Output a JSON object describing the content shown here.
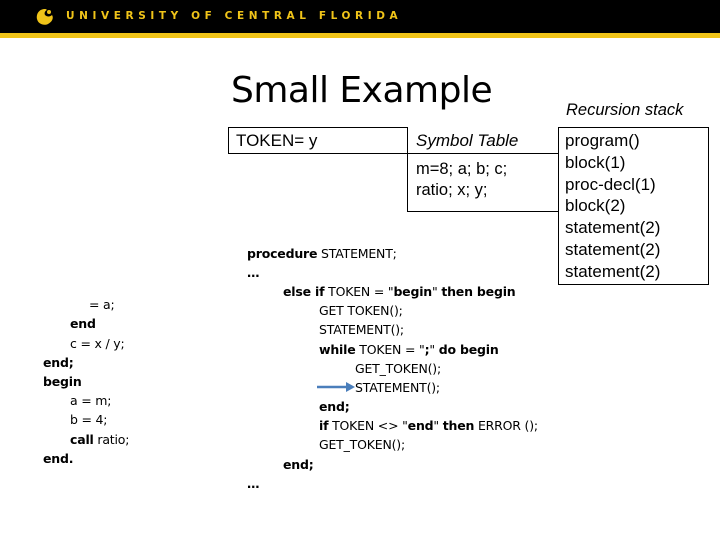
{
  "header": {
    "university_name": "UNIVERSITY OF CENTRAL FLORIDA",
    "logo_icon": "ucf-pegasus-logo-icon",
    "brand_colors": {
      "bar": "#000000",
      "accent": "#f0c419"
    }
  },
  "slide": {
    "title": "Small Example",
    "token_label": "TOKEN= y",
    "symbol_table": {
      "header": "Symbol Table",
      "lines": [
        "m=8; a; b; c;",
        "ratio; x; y;"
      ]
    },
    "recursion_stack": {
      "header": "Recursion stack",
      "items": [
        "program()",
        "block(1)",
        "proc-decl(1)",
        "block(2)",
        "statement(2)",
        "statement(2)",
        "statement(2)"
      ]
    },
    "left_code": [
      {
        "kw": "",
        "rest": "= a;"
      },
      {
        "kw": "end",
        "rest": ""
      },
      {
        "kw": "",
        "rest": "c = x / y;"
      },
      {
        "kw": "end;",
        "rest": ""
      },
      {
        "kw": "begin",
        "rest": ""
      },
      {
        "kw": "",
        "rest": "a = m;"
      },
      {
        "kw": "",
        "rest": "b = 4;"
      },
      {
        "kw": "call",
        "rest": " ratio;"
      },
      {
        "kw": "end.",
        "rest": ""
      }
    ],
    "procedure_code": [
      {
        "a": "procedure",
        "b": " STATEMENT;"
      },
      {
        "a": "…",
        "b": ""
      },
      {
        "a": "else if",
        "b": " TOKEN = \"",
        "c": "begin",
        "d": "\" ",
        "e": "then begin"
      },
      {
        "a": "",
        "b": "GET TOKEN();"
      },
      {
        "a": "",
        "b": "STATEMENT();"
      },
      {
        "a": "while",
        "b": " TOKEN = \"",
        "c": ";",
        "d": "\" ",
        "e": "do begin"
      },
      {
        "a": "",
        "b": "GET_TOKEN();"
      },
      {
        "a": "",
        "b": "STATEMENT();"
      },
      {
        "a": "end;",
        "b": ""
      },
      {
        "a": "if",
        "b": " TOKEN <> \"",
        "c": "end",
        "d": "\" ",
        "e": "then",
        "f": " ERROR ();"
      },
      {
        "a": "",
        "b": "GET_TOKEN();"
      },
      {
        "a": "end;",
        "b": ""
      },
      {
        "a": "…",
        "b": ""
      }
    ],
    "arrow_icon": "current-line-arrow-icon",
    "arrow_color": "#4a7ebb"
  }
}
